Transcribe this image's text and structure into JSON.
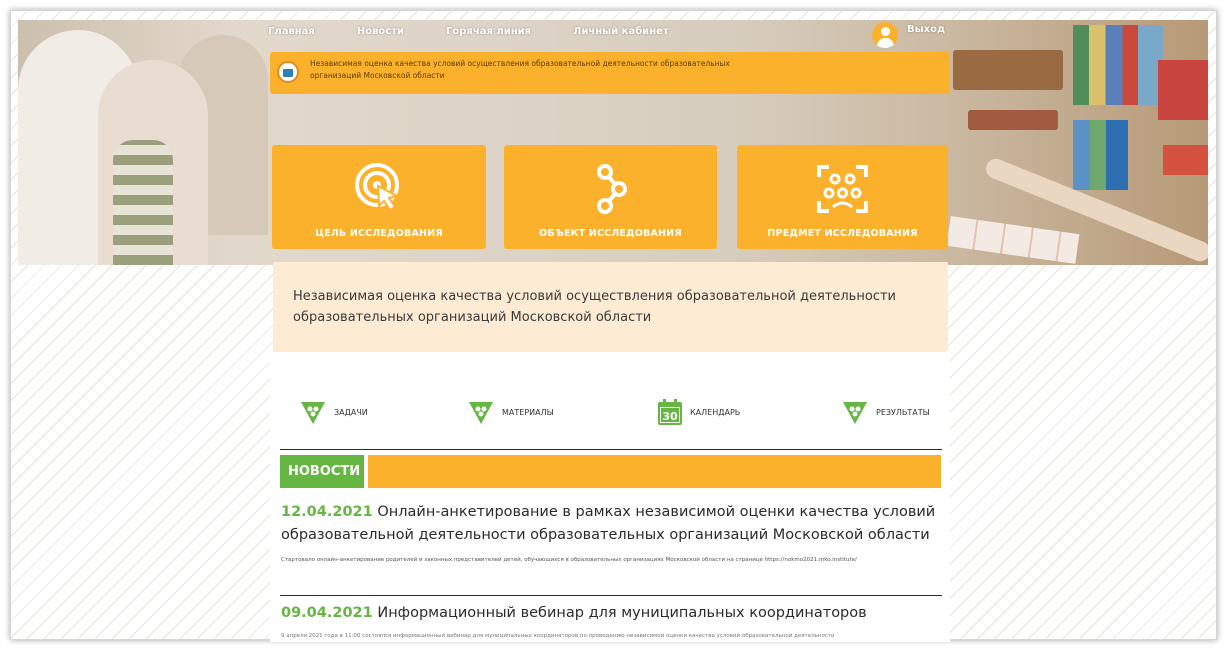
{
  "nav": {
    "items": [
      "Главная",
      "Новости",
      "Горячая линия",
      "Личный кабинет"
    ],
    "logout": "Выход"
  },
  "banner": {
    "org_text": "Независимая оценка качества условий осуществления образовательной деятельности образовательных организаций Московской области"
  },
  "tiles": [
    {
      "label": "ЦЕЛЬ ИССЛЕДОВАНИЯ",
      "icon": "target-click-icon"
    },
    {
      "label": "ОБЪЕКТ ИССЛЕДОВАНИЯ",
      "icon": "share-nodes-icon"
    },
    {
      "label": "ПРЕДМЕТ ИССЛЕДОВАНИЯ",
      "icon": "group-focus-icon"
    }
  ],
  "intro": {
    "text": "Независимая оценка качества условий осуществления образовательной деятельности образовательных организаций Московской области"
  },
  "quick_links": [
    {
      "label": "ЗАДАЧИ",
      "icon": "green-triangle-icon"
    },
    {
      "label": "МАТЕРИАЛЫ",
      "icon": "green-triangle-icon"
    },
    {
      "label": "КАЛЕНДАРЬ",
      "icon": "calendar-icon",
      "icon_text": "30"
    },
    {
      "label": "РЕЗУЛЬТАТЫ",
      "icon": "green-triangle-icon"
    }
  ],
  "news": {
    "heading": "НОВОСТИ",
    "items": [
      {
        "date": "12.04.2021",
        "title": "Онлайн-анкетирование в рамках независимой оценки качества условий образовательной деятельности образовательных организаций Московской области",
        "summary": "Стартовало онлайн-анкетирование родителей и законных представителей детей, обучающихся в образовательных организациях Московской области на странице https://nokmo2021.mko.institute/"
      },
      {
        "date": "09.04.2021",
        "title": "Информационный вебинар для муниципальных координаторов",
        "summary": "9 апреля 2021 года в 11:00 состоялся информационный вебинар для муниципальных координаторов по проведению независимой оценки качества условий образовательной деятельности"
      }
    ]
  },
  "colors": {
    "orange": "#fbb12c",
    "green": "#65b642",
    "cream": "#fdebd3"
  }
}
